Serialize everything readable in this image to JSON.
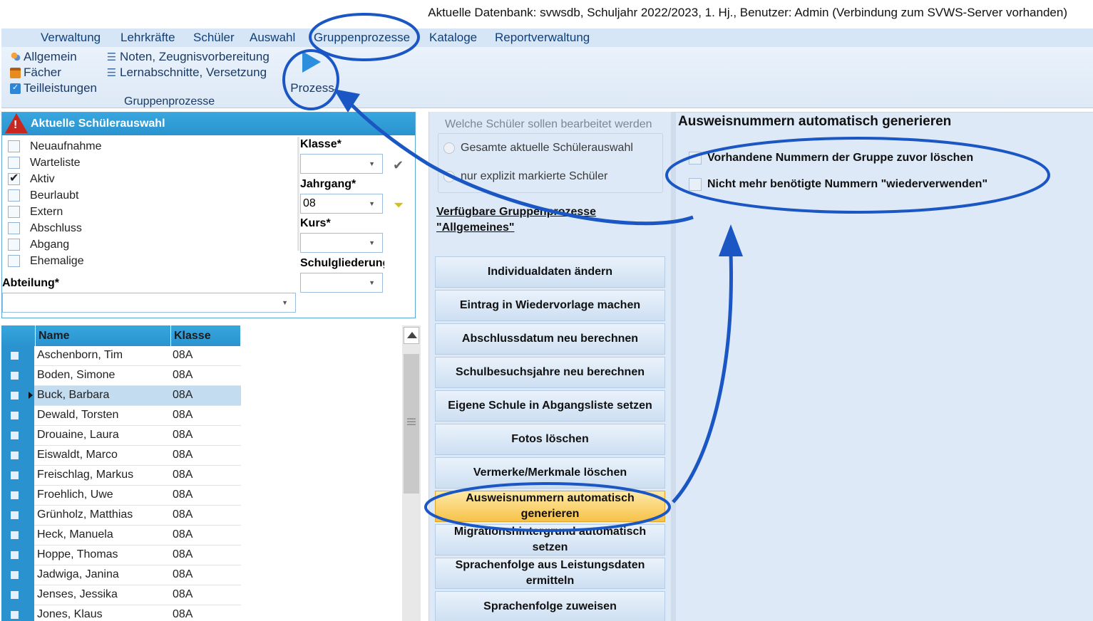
{
  "status_line": "Aktuelle Datenbank: svwsdb, Schuljahr 2022/2023, 1. Hj., Benutzer: Admin (Verbindung zum SVWS-Server vorhanden)",
  "menu": [
    "Verwaltung",
    "Lehrkräfte",
    "Schüler",
    "Auswahl",
    "Gruppenprozesse",
    "Kataloge",
    "Reportverwaltung"
  ],
  "ribbon": {
    "col1": [
      {
        "label": "Allgemein",
        "icon": "people-icon"
      },
      {
        "label": "Fächer",
        "icon": "bag-icon"
      },
      {
        "label": "Teilleistungen",
        "icon": "document-check-icon"
      }
    ],
    "col2": [
      {
        "label": "Noten, Zeugnisvorbereitung",
        "icon": "list-icon"
      },
      {
        "label": "Lernabschnitte, Versetzung",
        "icon": "list-icon"
      }
    ],
    "process_button": "Prozess",
    "group_label": "Gruppenprozesse"
  },
  "filter": {
    "header": "Aktuelle Schülerauswahl",
    "status_items": [
      {
        "label": "Neuaufnahme",
        "checked": false
      },
      {
        "label": "Warteliste",
        "checked": false
      },
      {
        "label": "Aktiv",
        "checked": true
      },
      {
        "label": "Beurlaubt",
        "checked": false
      },
      {
        "label": "Extern",
        "checked": false
      },
      {
        "label": "Abschluss",
        "checked": false
      },
      {
        "label": "Abgang",
        "checked": false
      },
      {
        "label": "Ehemalige",
        "checked": false
      }
    ],
    "klasse_label": "Klasse*",
    "klasse_value": "",
    "jahrgang_label": "Jahrgang*",
    "jahrgang_value": "08",
    "kurs_label": "Kurs*",
    "kurs_value": "",
    "schulgliederung_label": "Schulgliederung",
    "schulgliederung_value": "",
    "abteilung_label": "Abteilung*",
    "abteilung_value": ""
  },
  "table": {
    "headers": [
      "Name",
      "Klasse"
    ],
    "rows": [
      {
        "name": "Aschenborn, Tim",
        "klasse": "08A"
      },
      {
        "name": "Boden, Simone",
        "klasse": "08A"
      },
      {
        "name": "Buck, Barbara",
        "klasse": "08A"
      },
      {
        "name": "Dewald, Torsten",
        "klasse": "08A"
      },
      {
        "name": "Drouaine, Laura",
        "klasse": "08A"
      },
      {
        "name": "Eiswaldt, Marco",
        "klasse": "08A"
      },
      {
        "name": "Freischlag, Markus",
        "klasse": "08A"
      },
      {
        "name": "Froehlich, Uwe",
        "klasse": "08A"
      },
      {
        "name": "Grünholz, Matthias",
        "klasse": "08A"
      },
      {
        "name": "Heck, Manuela",
        "klasse": "08A"
      },
      {
        "name": "Hoppe, Thomas",
        "klasse": "08A"
      },
      {
        "name": "Jadwiga, Janina",
        "klasse": "08A"
      },
      {
        "name": "Jenses, Jessika",
        "klasse": "08A"
      },
      {
        "name": "Jones, Klaus",
        "klasse": "08A"
      }
    ],
    "active_row": 2
  },
  "middle": {
    "groupbox_title": "Welche Schüler sollen bearbeitet werden",
    "radio_all": "Gesamte aktuelle Schülerauswahl",
    "radio_marked": "nur explizit markierte Schüler",
    "available_line1": "Verfügbare Gruppenprozesse",
    "available_line2": "\"Allgemeines\"",
    "processes": [
      "Individualdaten ändern",
      "Eintrag in Wiedervorlage machen",
      "Abschlussdatum neu berechnen",
      "Schulbesuchsjahre neu berechnen",
      "Eigene Schule in Abgangsliste setzen",
      "Fotos löschen",
      "Vermerke/Merkmale löschen",
      "Ausweisnummern automatisch generieren",
      "Migrationshintergrund automatisch setzen",
      "Sprachenfolge aus Leistungsdaten ermitteln",
      "Sprachenfolge zuweisen"
    ],
    "selected_process": 7
  },
  "right": {
    "title": "Ausweisnummern automatisch generieren",
    "options": [
      {
        "label": "Vorhandene Nummern der Gruppe zuvor löschen",
        "checked": false
      },
      {
        "label": "Nicht mehr benötigte Nummern \"wiederverwenden\"",
        "checked": false
      }
    ]
  },
  "colors": {
    "header_blue": "#2a93cf",
    "panel_bg": "#dde9f6",
    "selected_button": "#f6c24a",
    "annotation": "#1a56c4"
  }
}
